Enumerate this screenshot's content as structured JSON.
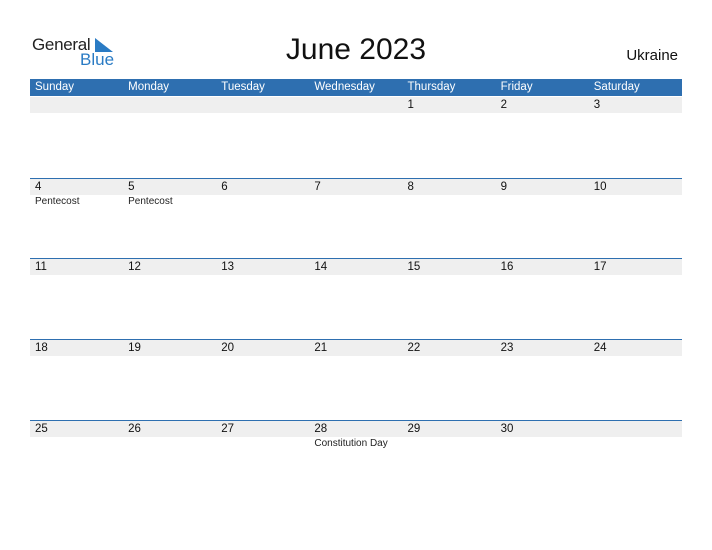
{
  "logo": {
    "word1": "General",
    "word2": "Blue",
    "brand_color": "#2a7bc4"
  },
  "title": "June 2023",
  "country": "Ukraine",
  "header_color": "#2e6fb0",
  "weekdays": [
    "Sunday",
    "Monday",
    "Tuesday",
    "Wednesday",
    "Thursday",
    "Friday",
    "Saturday"
  ],
  "weeks": [
    {
      "days": [
        "",
        "",
        "",
        "",
        "1",
        "2",
        "3"
      ],
      "events": [
        "",
        "",
        "",
        "",
        "",
        "",
        ""
      ]
    },
    {
      "days": [
        "4",
        "5",
        "6",
        "7",
        "8",
        "9",
        "10"
      ],
      "events": [
        "Pentecost",
        "Pentecost",
        "",
        "",
        "",
        "",
        ""
      ]
    },
    {
      "days": [
        "11",
        "12",
        "13",
        "14",
        "15",
        "16",
        "17"
      ],
      "events": [
        "",
        "",
        "",
        "",
        "",
        "",
        ""
      ]
    },
    {
      "days": [
        "18",
        "19",
        "20",
        "21",
        "22",
        "23",
        "24"
      ],
      "events": [
        "",
        "",
        "",
        "",
        "",
        "",
        ""
      ]
    },
    {
      "days": [
        "25",
        "26",
        "27",
        "28",
        "29",
        "30",
        ""
      ],
      "events": [
        "",
        "",
        "",
        "Constitution Day",
        "",
        "",
        ""
      ]
    }
  ]
}
